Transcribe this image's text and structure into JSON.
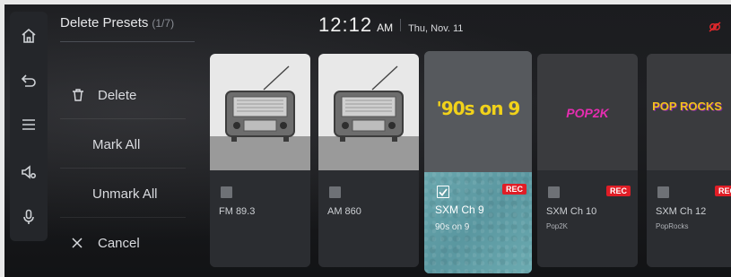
{
  "header": {
    "title": "Delete Presets",
    "count": "(1/7)",
    "time": "12:12",
    "ampm": "AM",
    "date": "Thu, Nov. 11"
  },
  "rail": {
    "icons": [
      "home-icon",
      "back-icon",
      "menu-icon",
      "sound-settings-icon",
      "microphone-icon"
    ]
  },
  "menu": {
    "delete": "Delete",
    "mark_all": "Mark All",
    "unmark_all": "Unmark All",
    "cancel": "Cancel"
  },
  "presets": [
    {
      "name": "FM 89.3",
      "sub": "",
      "rec": false,
      "selected": false,
      "art": "radio-image"
    },
    {
      "name": "AM 860",
      "sub": "",
      "rec": false,
      "selected": false,
      "art": "radio-image"
    },
    {
      "name": "SXM Ch 9",
      "sub": "90s on 9",
      "rec": true,
      "rec_label": "REC",
      "selected": true,
      "art": "90s-on-9-logo",
      "logo": "'90s on 9"
    },
    {
      "name": "SXM Ch 10",
      "sub": "Pop2K",
      "rec": true,
      "rec_label": "REC",
      "selected": false,
      "art": "pop2k-logo",
      "logo": "POP2K"
    },
    {
      "name": "SXM Ch 12",
      "sub": "PopRocks",
      "rec": true,
      "rec_label": "REC",
      "selected": false,
      "art": "poprocks-logo",
      "logo": "POP ROCKS"
    }
  ],
  "colors": {
    "rec_badge": "#e01d26",
    "selected_tile": "#5f9ea6",
    "status_warning": "#e0282c"
  }
}
